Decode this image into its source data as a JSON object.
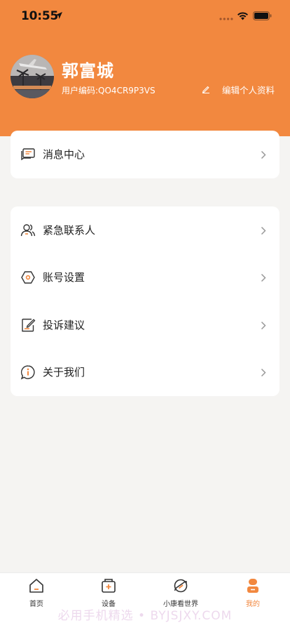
{
  "status": {
    "time": "10:55"
  },
  "profile": {
    "name": "郭富城",
    "code_label": "用户编码:QO4CR9P3VS",
    "edit_label": "编辑个人资料"
  },
  "menu_top": [
    {
      "label": "消息中心",
      "icon": "message-icon"
    }
  ],
  "menu_main": [
    {
      "label": "紧急联系人",
      "icon": "contacts-icon"
    },
    {
      "label": "账号设置",
      "icon": "settings-icon"
    },
    {
      "label": "投诉建议",
      "icon": "feedback-icon"
    },
    {
      "label": "关于我们",
      "icon": "info-icon"
    }
  ],
  "tabs": [
    {
      "label": "首页",
      "icon": "home-icon"
    },
    {
      "label": "设备",
      "icon": "device-icon"
    },
    {
      "label": "小康看世界",
      "icon": "planet-icon"
    },
    {
      "label": "我的",
      "icon": "profile-icon",
      "active": true
    }
  ],
  "colors": {
    "accent": "#f2883f",
    "background": "#f5f4f2"
  },
  "watermark": "必用手机精选 • BYJSJXY.COM"
}
